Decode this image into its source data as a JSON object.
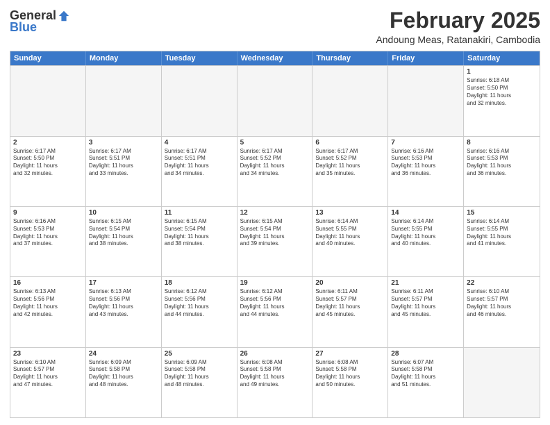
{
  "header": {
    "logo": {
      "general": "General",
      "blue": "Blue"
    },
    "month": "February 2025",
    "location": "Andoung Meas, Ratanakiri, Cambodia"
  },
  "weekdays": [
    "Sunday",
    "Monday",
    "Tuesday",
    "Wednesday",
    "Thursday",
    "Friday",
    "Saturday"
  ],
  "weeks": [
    [
      {
        "day": "",
        "info": ""
      },
      {
        "day": "",
        "info": ""
      },
      {
        "day": "",
        "info": ""
      },
      {
        "day": "",
        "info": ""
      },
      {
        "day": "",
        "info": ""
      },
      {
        "day": "",
        "info": ""
      },
      {
        "day": "1",
        "info": "Sunrise: 6:18 AM\nSunset: 5:50 PM\nDaylight: 11 hours\nand 32 minutes."
      }
    ],
    [
      {
        "day": "2",
        "info": "Sunrise: 6:17 AM\nSunset: 5:50 PM\nDaylight: 11 hours\nand 32 minutes."
      },
      {
        "day": "3",
        "info": "Sunrise: 6:17 AM\nSunset: 5:51 PM\nDaylight: 11 hours\nand 33 minutes."
      },
      {
        "day": "4",
        "info": "Sunrise: 6:17 AM\nSunset: 5:51 PM\nDaylight: 11 hours\nand 34 minutes."
      },
      {
        "day": "5",
        "info": "Sunrise: 6:17 AM\nSunset: 5:52 PM\nDaylight: 11 hours\nand 34 minutes."
      },
      {
        "day": "6",
        "info": "Sunrise: 6:17 AM\nSunset: 5:52 PM\nDaylight: 11 hours\nand 35 minutes."
      },
      {
        "day": "7",
        "info": "Sunrise: 6:16 AM\nSunset: 5:53 PM\nDaylight: 11 hours\nand 36 minutes."
      },
      {
        "day": "8",
        "info": "Sunrise: 6:16 AM\nSunset: 5:53 PM\nDaylight: 11 hours\nand 36 minutes."
      }
    ],
    [
      {
        "day": "9",
        "info": "Sunrise: 6:16 AM\nSunset: 5:53 PM\nDaylight: 11 hours\nand 37 minutes."
      },
      {
        "day": "10",
        "info": "Sunrise: 6:15 AM\nSunset: 5:54 PM\nDaylight: 11 hours\nand 38 minutes."
      },
      {
        "day": "11",
        "info": "Sunrise: 6:15 AM\nSunset: 5:54 PM\nDaylight: 11 hours\nand 38 minutes."
      },
      {
        "day": "12",
        "info": "Sunrise: 6:15 AM\nSunset: 5:54 PM\nDaylight: 11 hours\nand 39 minutes."
      },
      {
        "day": "13",
        "info": "Sunrise: 6:14 AM\nSunset: 5:55 PM\nDaylight: 11 hours\nand 40 minutes."
      },
      {
        "day": "14",
        "info": "Sunrise: 6:14 AM\nSunset: 5:55 PM\nDaylight: 11 hours\nand 40 minutes."
      },
      {
        "day": "15",
        "info": "Sunrise: 6:14 AM\nSunset: 5:55 PM\nDaylight: 11 hours\nand 41 minutes."
      }
    ],
    [
      {
        "day": "16",
        "info": "Sunrise: 6:13 AM\nSunset: 5:56 PM\nDaylight: 11 hours\nand 42 minutes."
      },
      {
        "day": "17",
        "info": "Sunrise: 6:13 AM\nSunset: 5:56 PM\nDaylight: 11 hours\nand 43 minutes."
      },
      {
        "day": "18",
        "info": "Sunrise: 6:12 AM\nSunset: 5:56 PM\nDaylight: 11 hours\nand 44 minutes."
      },
      {
        "day": "19",
        "info": "Sunrise: 6:12 AM\nSunset: 5:56 PM\nDaylight: 11 hours\nand 44 minutes."
      },
      {
        "day": "20",
        "info": "Sunrise: 6:11 AM\nSunset: 5:57 PM\nDaylight: 11 hours\nand 45 minutes."
      },
      {
        "day": "21",
        "info": "Sunrise: 6:11 AM\nSunset: 5:57 PM\nDaylight: 11 hours\nand 45 minutes."
      },
      {
        "day": "22",
        "info": "Sunrise: 6:10 AM\nSunset: 5:57 PM\nDaylight: 11 hours\nand 46 minutes."
      }
    ],
    [
      {
        "day": "23",
        "info": "Sunrise: 6:10 AM\nSunset: 5:57 PM\nDaylight: 11 hours\nand 47 minutes."
      },
      {
        "day": "24",
        "info": "Sunrise: 6:09 AM\nSunset: 5:58 PM\nDaylight: 11 hours\nand 48 minutes."
      },
      {
        "day": "25",
        "info": "Sunrise: 6:09 AM\nSunset: 5:58 PM\nDaylight: 11 hours\nand 48 minutes."
      },
      {
        "day": "26",
        "info": "Sunrise: 6:08 AM\nSunset: 5:58 PM\nDaylight: 11 hours\nand 49 minutes."
      },
      {
        "day": "27",
        "info": "Sunrise: 6:08 AM\nSunset: 5:58 PM\nDaylight: 11 hours\nand 50 minutes."
      },
      {
        "day": "28",
        "info": "Sunrise: 6:07 AM\nSunset: 5:58 PM\nDaylight: 11 hours\nand 51 minutes."
      },
      {
        "day": "",
        "info": ""
      }
    ]
  ]
}
